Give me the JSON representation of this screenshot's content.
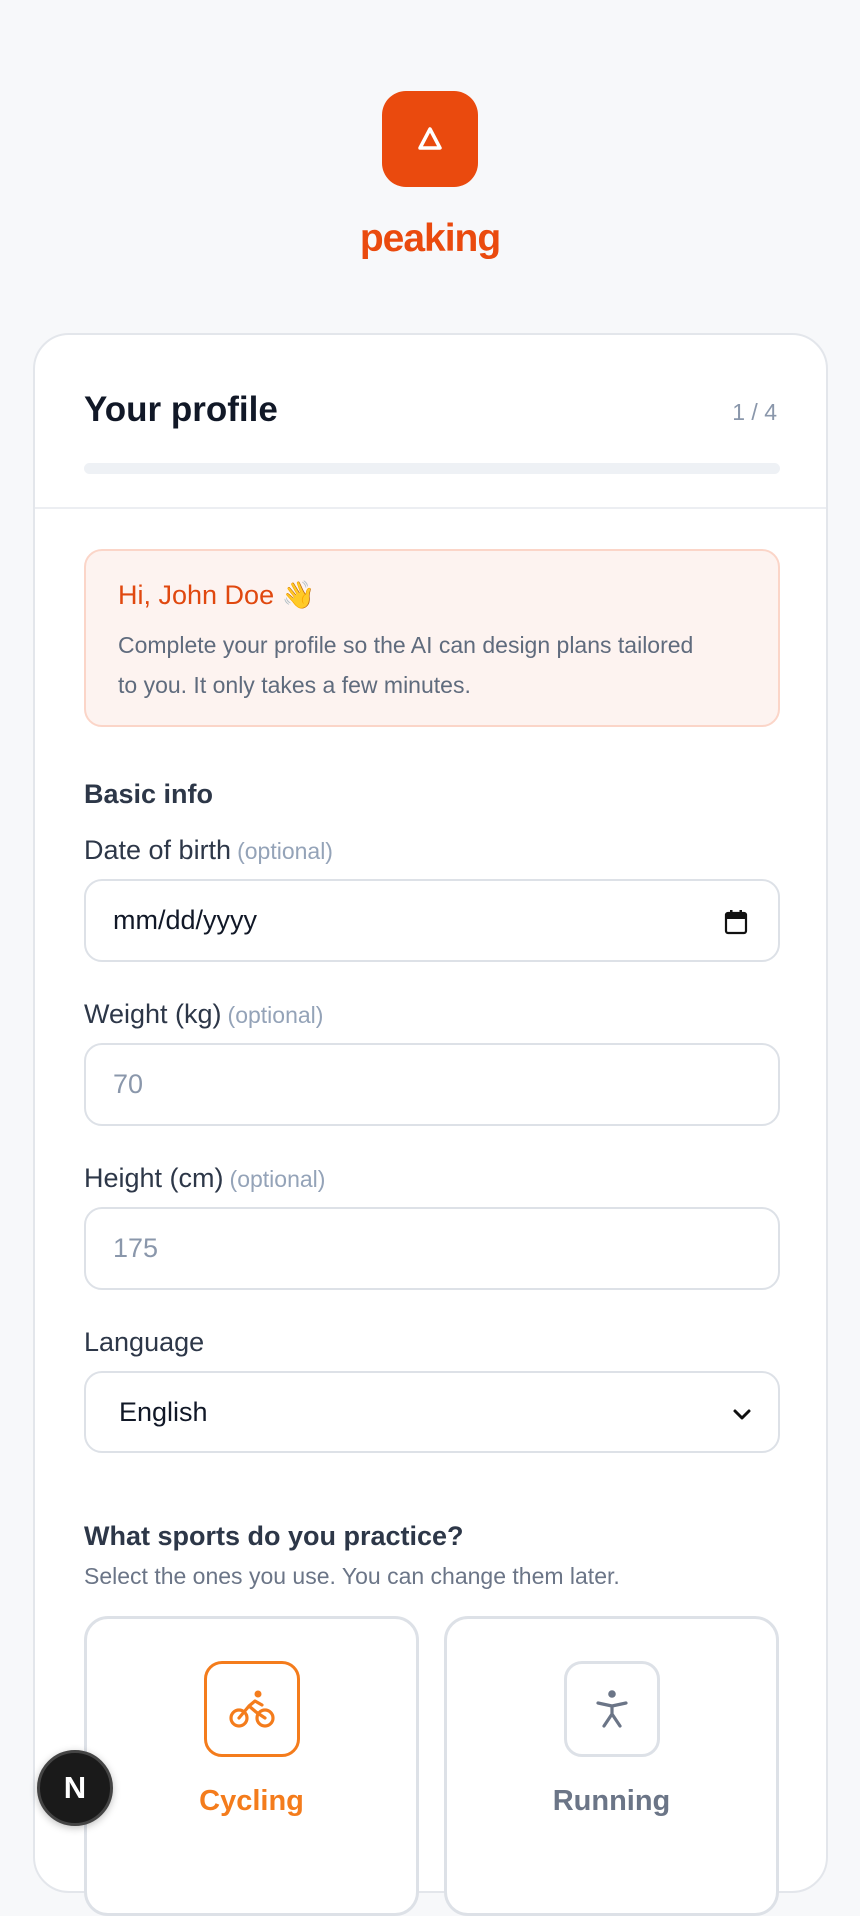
{
  "brand": {
    "name": "peaking",
    "logo_icon": "delta-triangle-icon",
    "color": "#ea4a0e"
  },
  "card": {
    "title": "Your profile",
    "step": "1 / 4",
    "progress": 0
  },
  "welcome": {
    "title": "Hi, John Doe 👋",
    "text": "Complete your profile so the AI can design plans tailored to you. It only takes a few minutes."
  },
  "basic_info": {
    "heading": "Basic info",
    "dob": {
      "label": "Date of birth",
      "optional": "(optional)",
      "placeholder": "mm/dd/yyyy",
      "icon": "calendar-icon"
    },
    "weight": {
      "label": "Weight (kg)",
      "optional": "(optional)",
      "placeholder": "70"
    },
    "height": {
      "label": "Height (cm)",
      "optional": "(optional)",
      "placeholder": "175"
    },
    "language": {
      "label": "Language",
      "value": "English",
      "icon": "chevron-down-icon"
    }
  },
  "sports": {
    "title": "What sports do you practice?",
    "subtitle": "Select the ones you use. You can change them later.",
    "items": [
      {
        "label": "Cycling",
        "icon": "bicycle-icon",
        "selected": true
      },
      {
        "label": "Running",
        "icon": "runner-icon",
        "selected": false
      }
    ]
  },
  "dev_badge": {
    "label": "N"
  },
  "colors": {
    "accent": "#ea4a0e",
    "selected": "#f47c1c"
  }
}
